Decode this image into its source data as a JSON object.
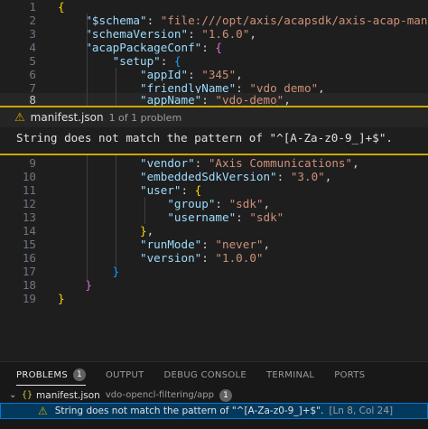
{
  "editor": {
    "lines": [
      {
        "n": "1",
        "tokens": [
          {
            "t": "{",
            "c": "b1"
          }
        ]
      },
      {
        "n": "2",
        "tokens": [
          {
            "t": "    ",
            "c": "p"
          },
          {
            "t": "\"$schema\"",
            "c": "k"
          },
          {
            "t": ": ",
            "c": "p"
          },
          {
            "t": "\"file:///opt/axis/acapsdk/axis-acap-mani",
            "c": "s"
          }
        ]
      },
      {
        "n": "3",
        "tokens": [
          {
            "t": "    ",
            "c": "p"
          },
          {
            "t": "\"schemaVersion\"",
            "c": "k"
          },
          {
            "t": ": ",
            "c": "p"
          },
          {
            "t": "\"1.6.0\"",
            "c": "s"
          },
          {
            "t": ",",
            "c": "p"
          }
        ]
      },
      {
        "n": "4",
        "tokens": [
          {
            "t": "    ",
            "c": "p"
          },
          {
            "t": "\"acapPackageConf\"",
            "c": "k"
          },
          {
            "t": ": ",
            "c": "p"
          },
          {
            "t": "{",
            "c": "b2"
          }
        ]
      },
      {
        "n": "5",
        "tokens": [
          {
            "t": "        ",
            "c": "p"
          },
          {
            "t": "\"setup\"",
            "c": "k"
          },
          {
            "t": ": ",
            "c": "p"
          },
          {
            "t": "{",
            "c": "b3"
          }
        ]
      },
      {
        "n": "6",
        "tokens": [
          {
            "t": "            ",
            "c": "p"
          },
          {
            "t": "\"appId\"",
            "c": "k"
          },
          {
            "t": ": ",
            "c": "p"
          },
          {
            "t": "\"345\"",
            "c": "s"
          },
          {
            "t": ",",
            "c": "p"
          }
        ]
      },
      {
        "n": "7",
        "tokens": [
          {
            "t": "            ",
            "c": "p"
          },
          {
            "t": "\"friendlyName\"",
            "c": "k"
          },
          {
            "t": ": ",
            "c": "p"
          },
          {
            "t": "\"vdo_demo\"",
            "c": "s"
          },
          {
            "t": ",",
            "c": "p"
          }
        ]
      },
      {
        "n": "8",
        "tokens": [
          {
            "t": "            ",
            "c": "p"
          },
          {
            "t": "\"appName\"",
            "c": "k"
          },
          {
            "t": ": ",
            "c": "p"
          },
          {
            "t": "\"vdo-demo\"",
            "c": "s sq"
          },
          {
            "t": ",",
            "c": "p"
          }
        ]
      },
      {
        "n": "9",
        "tokens": [
          {
            "t": "            ",
            "c": "p"
          },
          {
            "t": "\"vendor\"",
            "c": "k"
          },
          {
            "t": ": ",
            "c": "p"
          },
          {
            "t": "\"Axis Communications\"",
            "c": "s"
          },
          {
            "t": ",",
            "c": "p"
          }
        ]
      },
      {
        "n": "10",
        "tokens": [
          {
            "t": "            ",
            "c": "p"
          },
          {
            "t": "\"embeddedSdkVersion\"",
            "c": "k"
          },
          {
            "t": ": ",
            "c": "p"
          },
          {
            "t": "\"3.0\"",
            "c": "s"
          },
          {
            "t": ",",
            "c": "p"
          }
        ]
      },
      {
        "n": "11",
        "tokens": [
          {
            "t": "            ",
            "c": "p"
          },
          {
            "t": "\"user\"",
            "c": "k"
          },
          {
            "t": ": ",
            "c": "p"
          },
          {
            "t": "{",
            "c": "b1"
          }
        ]
      },
      {
        "n": "12",
        "tokens": [
          {
            "t": "                ",
            "c": "p"
          },
          {
            "t": "\"group\"",
            "c": "k"
          },
          {
            "t": ": ",
            "c": "p"
          },
          {
            "t": "\"sdk\"",
            "c": "s"
          },
          {
            "t": ",",
            "c": "p"
          }
        ]
      },
      {
        "n": "13",
        "tokens": [
          {
            "t": "                ",
            "c": "p"
          },
          {
            "t": "\"username\"",
            "c": "k"
          },
          {
            "t": ": ",
            "c": "p"
          },
          {
            "t": "\"sdk\"",
            "c": "s"
          }
        ]
      },
      {
        "n": "14",
        "tokens": [
          {
            "t": "            ",
            "c": "p"
          },
          {
            "t": "}",
            "c": "b1"
          },
          {
            "t": ",",
            "c": "p"
          }
        ]
      },
      {
        "n": "15",
        "tokens": [
          {
            "t": "            ",
            "c": "p"
          },
          {
            "t": "\"runMode\"",
            "c": "k"
          },
          {
            "t": ": ",
            "c": "p"
          },
          {
            "t": "\"never\"",
            "c": "s"
          },
          {
            "t": ",",
            "c": "p"
          }
        ]
      },
      {
        "n": "16",
        "tokens": [
          {
            "t": "            ",
            "c": "p"
          },
          {
            "t": "\"version\"",
            "c": "k"
          },
          {
            "t": ": ",
            "c": "p"
          },
          {
            "t": "\"1.0.0\"",
            "c": "s"
          }
        ]
      },
      {
        "n": "17",
        "tokens": [
          {
            "t": "        ",
            "c": "p"
          },
          {
            "t": "}",
            "c": "b3"
          }
        ]
      },
      {
        "n": "18",
        "tokens": [
          {
            "t": "    ",
            "c": "p"
          },
          {
            "t": "}",
            "c": "b2"
          }
        ]
      },
      {
        "n": "19",
        "tokens": [
          {
            "t": "}",
            "c": "b1"
          }
        ]
      }
    ],
    "active_line": "8"
  },
  "peek": {
    "icon": "warning-icon",
    "file": "manifest.json",
    "count": "1 of 1 problem",
    "message": "String does not match the pattern of \"^[A-Za-z0-9_]+$\"."
  },
  "panel": {
    "tabs": [
      {
        "label": "PROBLEMS",
        "badge": "1",
        "active": true
      },
      {
        "label": "OUTPUT"
      },
      {
        "label": "DEBUG CONSOLE"
      },
      {
        "label": "TERMINAL"
      },
      {
        "label": "PORTS"
      }
    ],
    "file_row": {
      "braces": "{}",
      "name": "manifest.json",
      "path": "vdo-opencl-filtering/app",
      "badge": "1"
    },
    "problem": {
      "message": "String does not match the pattern of \"^[A-Za-z0-9_]+$\".",
      "location": "[Ln 8, Col 24]"
    }
  },
  "colors": {
    "warning": "#cca700",
    "key": "#9cdcfe",
    "string": "#ce9178",
    "selection": "#04395e"
  }
}
